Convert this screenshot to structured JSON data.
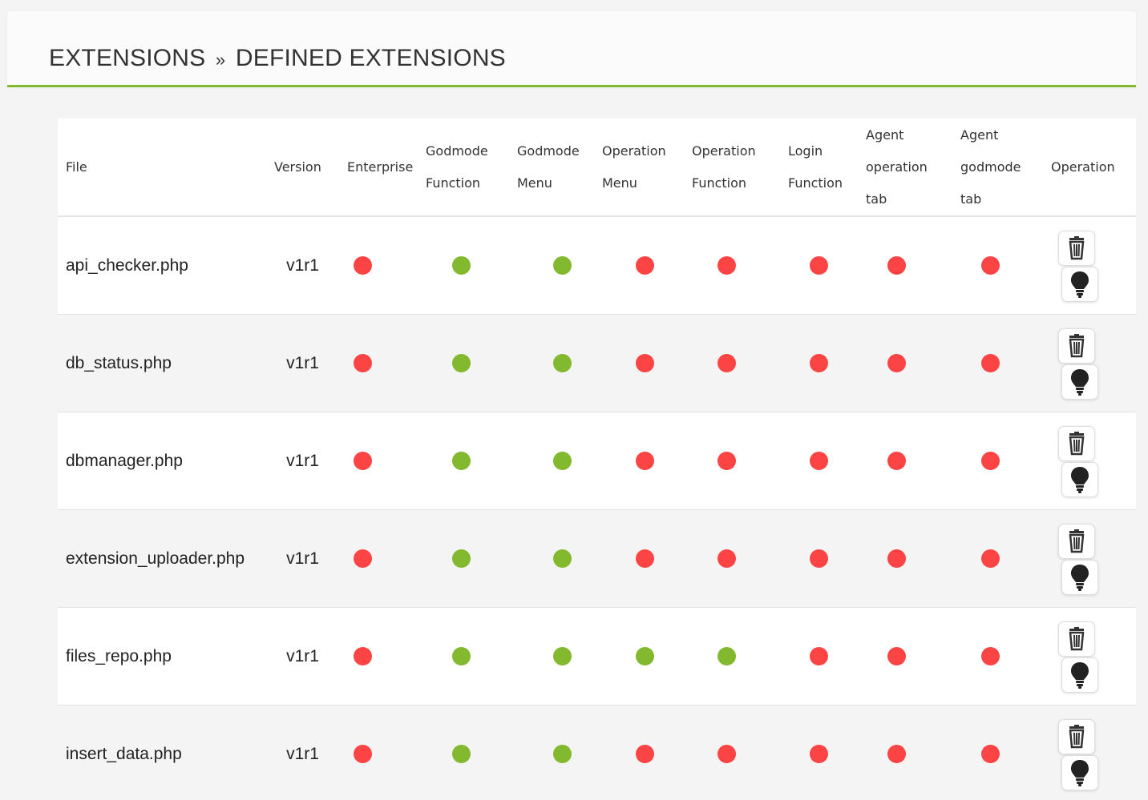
{
  "breadcrumb": {
    "parent": "EXTENSIONS",
    "separator": "»",
    "current": "DEFINED EXTENSIONS"
  },
  "colors": {
    "accent": "#82b92e",
    "enabled": "#82b92e",
    "disabled": "#fc4444"
  },
  "table": {
    "headers": [
      [
        "File"
      ],
      [
        "Version"
      ],
      [
        "Enterprise"
      ],
      [
        "Godmode",
        "Function"
      ],
      [
        "Godmode",
        "Menu"
      ],
      [
        "Operation",
        "Menu"
      ],
      [
        "Operation",
        "Function"
      ],
      [
        "Login",
        "Function"
      ],
      [
        "Agent",
        "operation",
        "tab"
      ],
      [
        "Agent",
        "godmode",
        "tab"
      ],
      [
        "Operation"
      ]
    ],
    "rows": [
      {
        "file": "api_checker.php",
        "version": "v1r1",
        "flags": [
          false,
          true,
          true,
          false,
          false,
          false,
          false,
          false
        ],
        "actions": [
          "delete-icon",
          "lightbulb-icon"
        ]
      },
      {
        "file": "db_status.php",
        "version": "v1r1",
        "flags": [
          false,
          true,
          true,
          false,
          false,
          false,
          false,
          false
        ],
        "actions": [
          "delete-icon",
          "lightbulb-icon"
        ]
      },
      {
        "file": "dbmanager.php",
        "version": "v1r1",
        "flags": [
          false,
          true,
          true,
          false,
          false,
          false,
          false,
          false
        ],
        "actions": [
          "delete-icon",
          "lightbulb-icon"
        ]
      },
      {
        "file": "extension_uploader.php",
        "version": "v1r1",
        "flags": [
          false,
          true,
          true,
          false,
          false,
          false,
          false,
          false
        ],
        "actions": [
          "delete-icon",
          "lightbulb-icon"
        ]
      },
      {
        "file": "files_repo.php",
        "version": "v1r1",
        "flags": [
          false,
          true,
          true,
          true,
          true,
          false,
          false,
          false
        ],
        "actions": [
          "delete-icon",
          "lightbulb-icon"
        ]
      },
      {
        "file": "insert_data.php",
        "version": "v1r1",
        "flags": [
          false,
          true,
          true,
          false,
          false,
          false,
          false,
          false
        ],
        "actions": [
          "delete-icon",
          "lightbulb-icon"
        ]
      }
    ]
  }
}
